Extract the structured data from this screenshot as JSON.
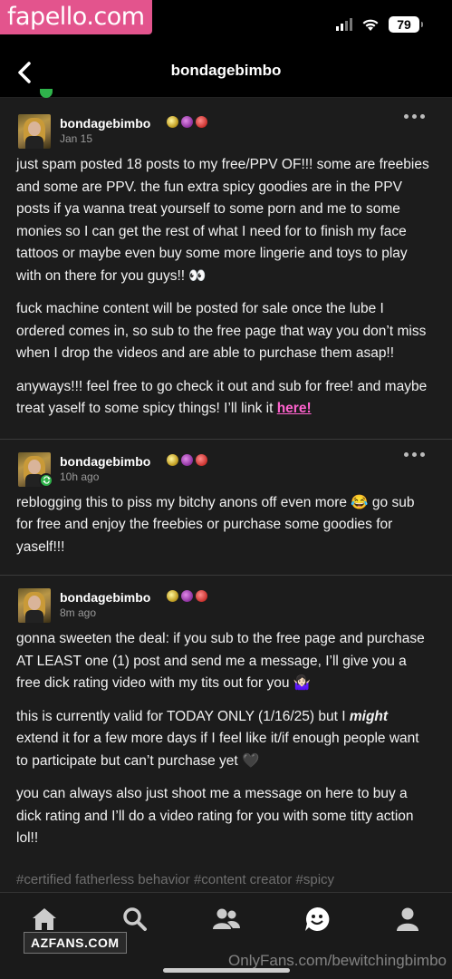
{
  "watermarks": {
    "top": "fapello.com",
    "left": "AZFANS.COM",
    "bottom": "OnlyFans.com/bewitchingbimbo"
  },
  "status": {
    "battery": "79"
  },
  "header": {
    "title": "bondagebimbo"
  },
  "posts": [
    {
      "username": "bondagebimbo",
      "date": "Jan 15",
      "paragraphs": [
        "just spam posted 18 posts to my free/PPV OF!!! some are freebies and some are PPV. the fun extra spicy goodies are in the PPV posts if ya wanna treat yourself to some porn and me to some monies so I can get the rest of what I need for to finish my face tattoos or maybe even buy some more lingerie and toys to play with on there for you guys!! 👀",
        "fuck machine content will be posted for sale once the lube I ordered comes in, so sub to the free page that way you don’t miss when I drop the videos and are able to purchase them asap!!",
        "anyways!!! feel free to go check it out and sub for free! and maybe treat yaself to some spicy things! I’ll link it "
      ],
      "link_text": "here!"
    },
    {
      "username": "bondagebimbo",
      "date": "10h ago",
      "paragraphs": [
        "reblogging this to piss my bitchy anons off even more 😂 go sub for free and enjoy the freebies or purchase some goodies for yaself!!!"
      ]
    },
    {
      "username": "bondagebimbo",
      "date": "8m ago",
      "paragraphs": [
        "gonna sweeten the deal: if you sub to the free page and purchase AT LEAST one (1) post and send me a message, I’ll give you a free dick rating video with my tits out for you 🤷🏻‍♀️"
      ],
      "p2_before": "this is currently valid for TODAY ONLY (1/16/25) but I ",
      "p2_em": "might",
      "p2_after": " extend it for a few more days if I feel like it/if enough people want to participate but can’t purchase yet 🖤",
      "p3": "you can always also just shoot me a message on here to buy a dick rating and I’ll do a video rating for you with some titty action lol!!",
      "tags": "#certified fatherless behavior  #content creator  #spicy"
    }
  ],
  "tabs": [
    "home",
    "search",
    "activity",
    "inbox",
    "account"
  ],
  "colors": {
    "link": "#ff62ce",
    "reblog": "#2fb34b",
    "feed_bg": "#1c1c1c"
  }
}
